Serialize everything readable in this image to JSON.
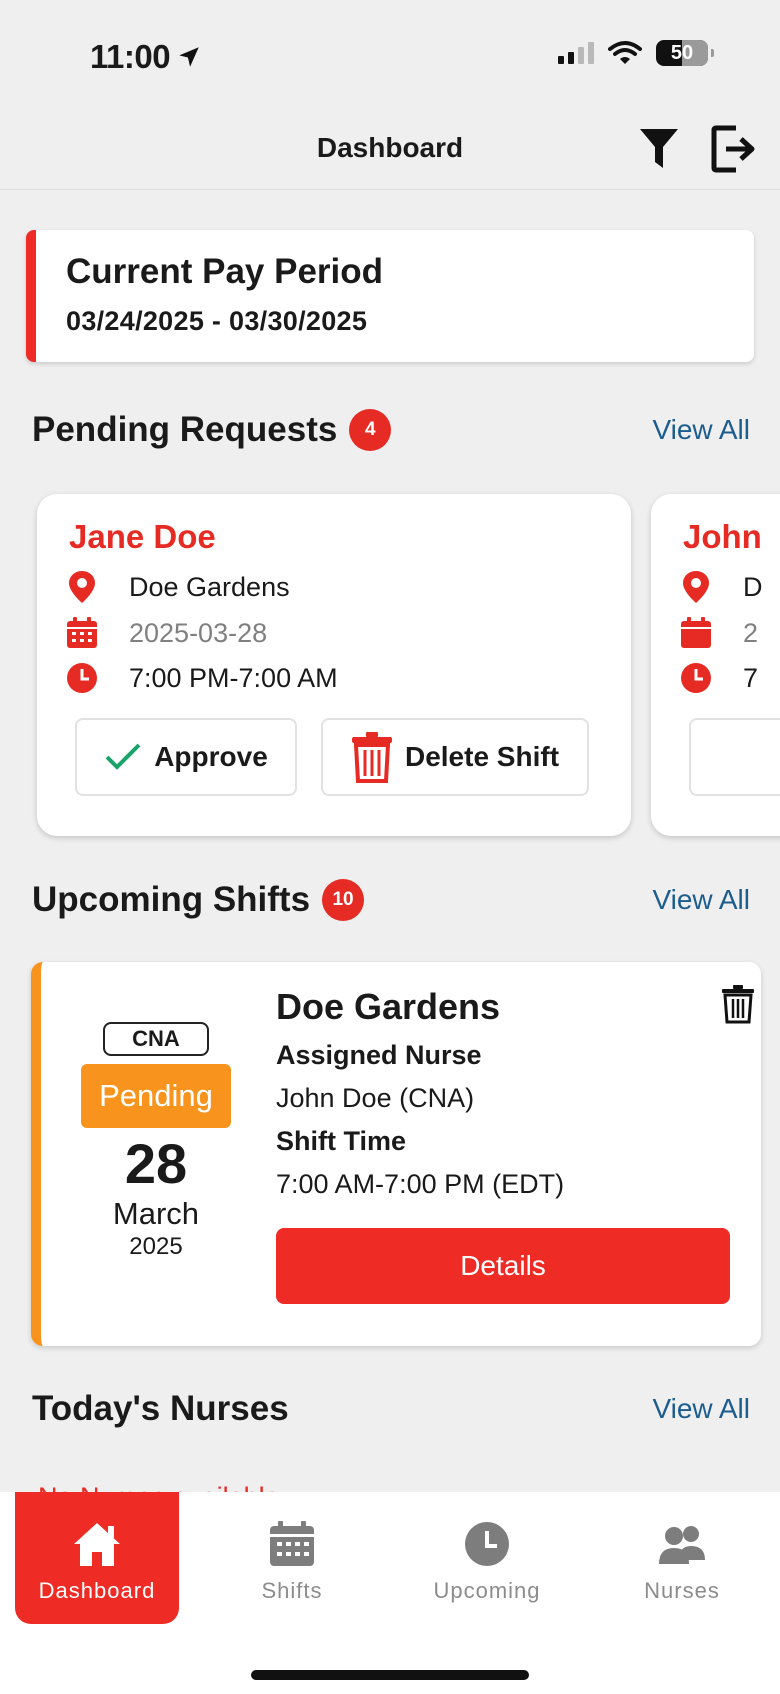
{
  "status_bar": {
    "time": "11:00",
    "battery": "50"
  },
  "header": {
    "title": "Dashboard"
  },
  "pay_period": {
    "title": "Current Pay Period",
    "range": "03/24/2025 - 03/30/2025"
  },
  "pending_requests": {
    "title": "Pending Requests",
    "count": "4",
    "view_all": "View All",
    "cards": [
      {
        "name": "Jane Doe",
        "facility": "Doe Gardens",
        "date": "2025-03-28",
        "time": "7:00 PM-7:00 AM",
        "approve": "Approve",
        "delete": "Delete Shift"
      },
      {
        "name": "John",
        "facility": "D",
        "date": "2",
        "time": "7"
      }
    ]
  },
  "upcoming_shifts": {
    "title": "Upcoming Shifts",
    "count": "10",
    "view_all": "View All",
    "shift": {
      "role": "CNA",
      "status": "Pending",
      "day": "28",
      "month": "March",
      "year": "2025",
      "facility": "Doe Gardens",
      "assigned_label": "Assigned Nurse",
      "assigned_value": "John Doe (CNA)",
      "time_label": "Shift Time",
      "time_value": "7:00 AM-7:00 PM (EDT)",
      "details": "Details"
    }
  },
  "todays_nurses": {
    "title": "Today's Nurses",
    "view_all": "View All",
    "empty": "No Nurses available"
  },
  "tabs": [
    {
      "label": "Dashboard",
      "icon": "home-icon",
      "active": true
    },
    {
      "label": "Shifts",
      "icon": "calendar-icon"
    },
    {
      "label": "Upcoming",
      "icon": "clock-icon"
    },
    {
      "label": "Nurses",
      "icon": "users-icon"
    }
  ],
  "colors": {
    "accent": "#ee2b24",
    "pending": "#f8941d",
    "link": "#1c5d8e"
  }
}
